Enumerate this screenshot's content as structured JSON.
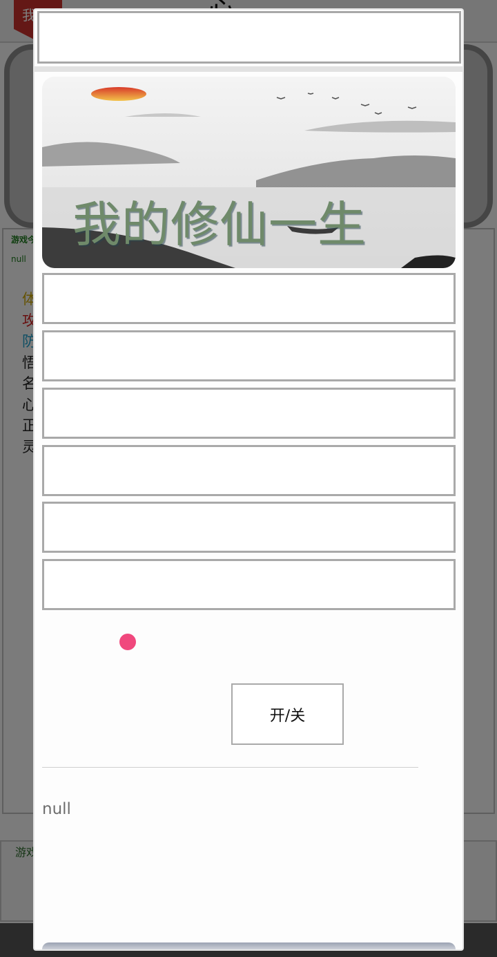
{
  "background": {
    "header_ribbon_text": "我的",
    "header_title": "心",
    "tip_label": "游戏今",
    "tip_value": "null",
    "stats": [
      {
        "char": "体",
        "color": "#c9a400"
      },
      {
        "char": "攻",
        "color": "#d02020"
      },
      {
        "char": "防",
        "color": "#1f9fc9"
      },
      {
        "char": "悟",
        "color": "#222222"
      },
      {
        "char": "名",
        "color": "#222222"
      },
      {
        "char": "心",
        "color": "#222222"
      },
      {
        "char": "正",
        "color": "#222222"
      },
      {
        "char": "灵",
        "color": "#222222"
      }
    ],
    "footer_log_label": "游戏"
  },
  "dialog": {
    "top_input_value": "",
    "banner_title": "我的修仙一生",
    "fields": [
      {
        "value": ""
      },
      {
        "value": ""
      },
      {
        "value": ""
      },
      {
        "value": ""
      },
      {
        "value": ""
      },
      {
        "value": ""
      }
    ],
    "indicator_color": "#f0487d",
    "toggle_label": "开/关",
    "status_text": "null"
  }
}
